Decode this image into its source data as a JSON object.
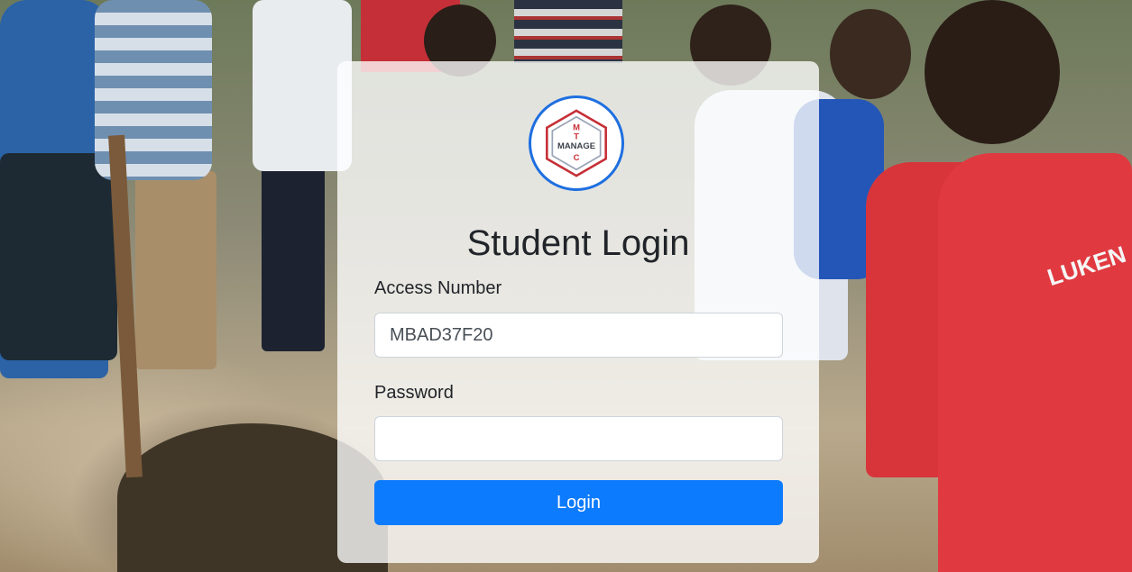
{
  "login": {
    "title": "Student Login",
    "access_label": "Access Number",
    "access_value": "MBAD37F20",
    "password_label": "Password",
    "password_value": "",
    "submit_label": "Login"
  },
  "logo": {
    "text_horizontal": "MANAGE",
    "text_vertical_top": "M",
    "text_vertical_mid": "T",
    "text_vertical_bottom": "C",
    "ring_color": "#1e6fe0",
    "hexagon_color": "#c62f36"
  },
  "background": {
    "shirt_text": "LUKEN"
  },
  "colors": {
    "primary_button": "#0d7bfd",
    "card_background": "rgba(255,255,255,0.78)"
  }
}
